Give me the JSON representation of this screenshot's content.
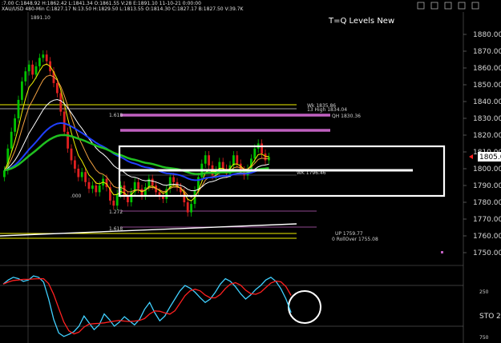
{
  "header": {
    "symbol": "XAU/USD",
    "info": ":7.00  C:1848.92  H:1862.42  L:1841.34  O:1861.55  V:28  E:1891.10  11-10-21  0:00:00",
    "info2": "XAU/USD  480-Min   C:1827.17   N:13.50   H:1829.50   L:1813.55   O:1814.30   C:1827.17   B:1827.50   V:39.7K",
    "top_scale": "1891.10"
  },
  "study_title": "T=Q Levels New",
  "price_axis": {
    "ticks": [
      "1880.00",
      "1870.00",
      "1860.00",
      "1850.00",
      "1840.00",
      "1830.00",
      "1820.00",
      "1810.00",
      "1800.00",
      "1790.00",
      "1780.00",
      "1770.00",
      "1760.00",
      "1750.00"
    ],
    "ticks_values": [
      1880,
      1870,
      1860,
      1850,
      1840,
      1830,
      1820,
      1810,
      1800,
      1790,
      1780,
      1770,
      1760,
      1750
    ],
    "current_price": "1805.0",
    "current_value": 1805
  },
  "level_labels": {
    "qh": "QH  1830.36",
    "high": "13 High  1834.04",
    "wk": "Wk  1835.86",
    "mid": "1.618",
    "dot": ".000",
    "l1": "1.272",
    "l2": "1.618",
    "up": "UP  1759.77",
    "rollover": "0 RollOver  1755.08",
    "wk_lo": "WK  1796.46"
  },
  "stoch": {
    "label": "STO",
    "suffix": "2",
    "tick_upper": "250",
    "tick_lower": "750"
  },
  "colors": {
    "background": "#000000",
    "bull": "#00c400",
    "bear": "#e02020",
    "level_magenta": "#c060c0",
    "level_yellow": "#f0f000",
    "stoch_cyan": "#40d0ff",
    "stoch_red": "#ff2020",
    "annot": "#ffffff"
  },
  "window_controls": [
    "minimize-icon",
    "restore-icon",
    "close-icon",
    "pin-icon",
    "help-icon"
  ]
}
